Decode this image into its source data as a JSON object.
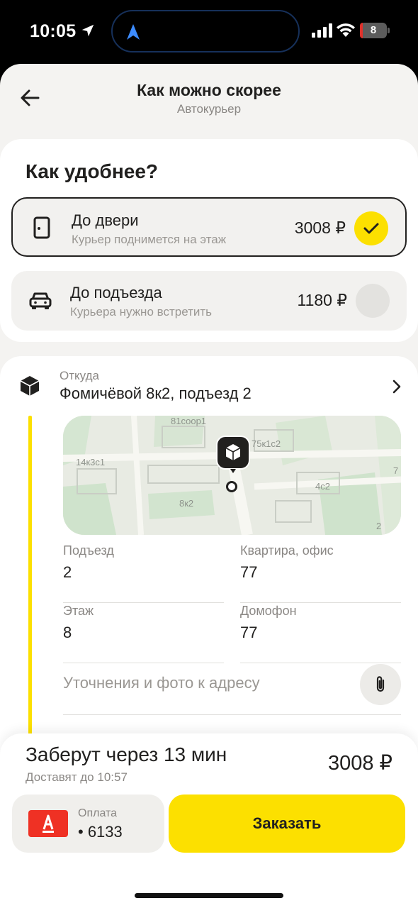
{
  "status_bar": {
    "time": "10:05",
    "battery": "8",
    "battery_level_percent": 8,
    "icons": [
      "location-arrow-icon",
      "navigation-arrow-icon",
      "signal-icon",
      "wifi-icon",
      "battery-icon"
    ]
  },
  "header": {
    "title": "Как можно скорее",
    "subtitle": "Автокурьер"
  },
  "delivery_options": {
    "title": "Как удобнее?",
    "items": [
      {
        "title": "До двери",
        "subtitle": "Курьер поднимется на этаж",
        "price": "3008 ₽",
        "selected": true,
        "icon": "door-icon"
      },
      {
        "title": "До подъезда",
        "subtitle": "Курьера нужно встретить",
        "price": "1180 ₽",
        "selected": false,
        "icon": "car-icon"
      }
    ]
  },
  "pickup": {
    "label": "Откуда",
    "address": "Фомичёвой 8к2, подъезд 2",
    "map_labels": [
      "81соор1",
      "75к1с2",
      "14к3с1",
      "8к2",
      "4с2",
      "7",
      "2"
    ],
    "fields": [
      {
        "label": "Подъезд",
        "value": "2"
      },
      {
        "label": "Квартира, офис",
        "value": "77"
      },
      {
        "label": "Этаж",
        "value": "8"
      },
      {
        "label": "Домофон",
        "value": "77"
      }
    ],
    "note_placeholder": "Уточнения и фото к адресу"
  },
  "footer": {
    "eta": "Заберут через 13 мин",
    "eta_sub": "Доставят до 10:57",
    "total": "3008 ₽",
    "payment_label": "Оплата",
    "payment_card": "• 6133",
    "order_button": "Заказать"
  },
  "colors": {
    "accent": "#fce000",
    "bank": "#ef3124",
    "background": "#f4f3f1"
  }
}
